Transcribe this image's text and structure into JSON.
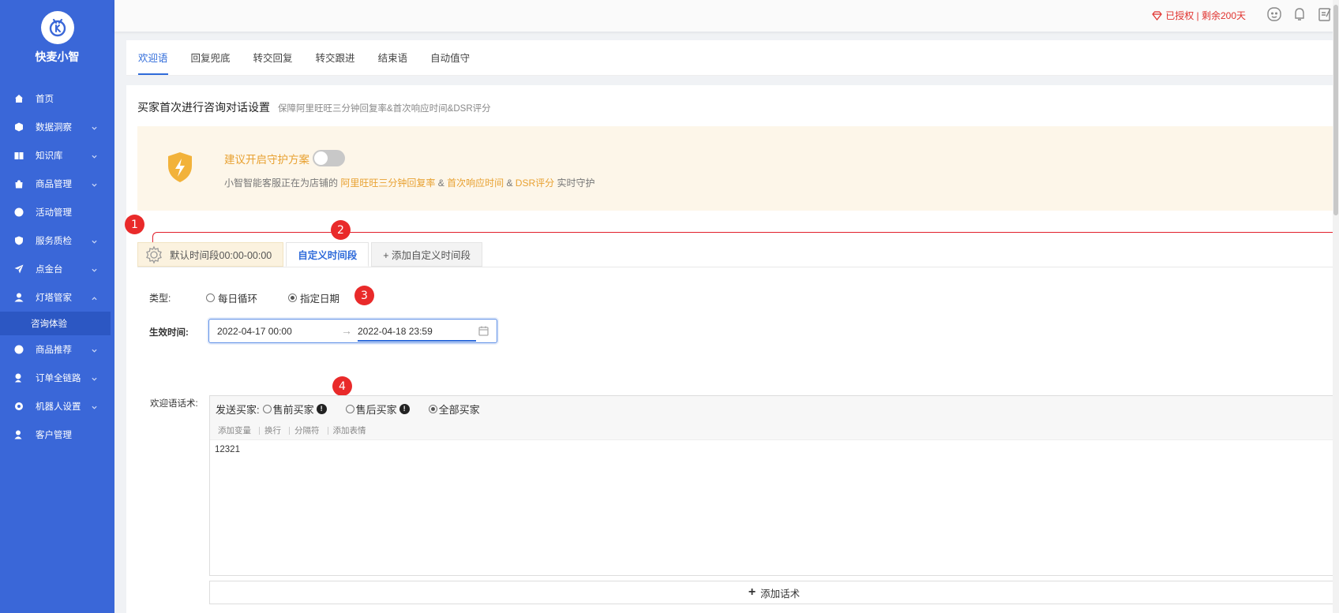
{
  "app": {
    "title": "快麦小智"
  },
  "sidebar": {
    "items": [
      {
        "label": "首页",
        "icon": "home-icon",
        "has_children": false
      },
      {
        "label": "数据洞察",
        "icon": "cube-icon",
        "has_children": true
      },
      {
        "label": "知识库",
        "icon": "book-icon",
        "has_children": true
      },
      {
        "label": "商品管理",
        "icon": "bag-icon",
        "has_children": true
      },
      {
        "label": "活动管理",
        "icon": "star-icon",
        "has_children": false
      },
      {
        "label": "服务质检",
        "icon": "shield-check-icon",
        "has_children": true
      },
      {
        "label": "点金台",
        "icon": "send-icon",
        "has_children": true
      },
      {
        "label": "灯塔管家",
        "icon": "user-icon",
        "has_children": true,
        "expanded": true
      },
      {
        "label": "商品推荐",
        "icon": "tag-icon",
        "has_children": true
      },
      {
        "label": "订单全链路",
        "icon": "link-icon",
        "has_children": true
      },
      {
        "label": "机器人设置",
        "icon": "gear-icon",
        "has_children": true
      },
      {
        "label": "客户管理",
        "icon": "users-icon",
        "has_children": false
      }
    ],
    "sub_item": "咨询体验"
  },
  "topbar": {
    "auth_text": "已授权 | 剩余200天"
  },
  "tabs": [
    "欢迎语",
    "回复兜底",
    "转交回复",
    "转交跟进",
    "结束语",
    "自动值守"
  ],
  "section": {
    "title": "买家首次进行咨询对话设置",
    "subtitle": "保障阿里旺旺三分钟回复率&首次响应时间&DSR评分"
  },
  "banner": {
    "title": "建议开启守护方案",
    "desc_prefix": "小智智能客服正在为店铺的",
    "hl1": "阿里旺旺三分钟回复率",
    "amp1": "&",
    "hl2": "首次响应时间",
    "amp2": "&",
    "hl3": "DSR评分",
    "desc_suffix": "实时守护"
  },
  "segment_tabs": {
    "default": "默认时间段00:00-00:00",
    "custom": "自定义时间段",
    "add": "+ 添加自定义时间段"
  },
  "form": {
    "type_label": "类型:",
    "type_options": [
      "每日循环",
      "指定日期"
    ],
    "type_selected": "指定日期",
    "effective_label": "生效时间:",
    "date_start": "2022-04-17 00:00",
    "date_end": "2022-04-18 23:59",
    "arrow": "→",
    "welcome_label": "欢迎语话术:"
  },
  "editor": {
    "send_label": "发送买家:",
    "options": [
      "售前买家",
      "售后买家",
      "全部买家"
    ],
    "selected": "全部买家",
    "toolbar": [
      "添加变量",
      "换行",
      "分隔符",
      "添加表情"
    ],
    "content": "12321"
  },
  "add_button": "添加话术",
  "badges": [
    "1",
    "2",
    "3",
    "4"
  ],
  "colors": {
    "sidebar": "#3a67d8",
    "accent": "#2f6bda",
    "warning": "#e8a131",
    "badge": "#e92a2a",
    "auth": "#e0322e"
  }
}
